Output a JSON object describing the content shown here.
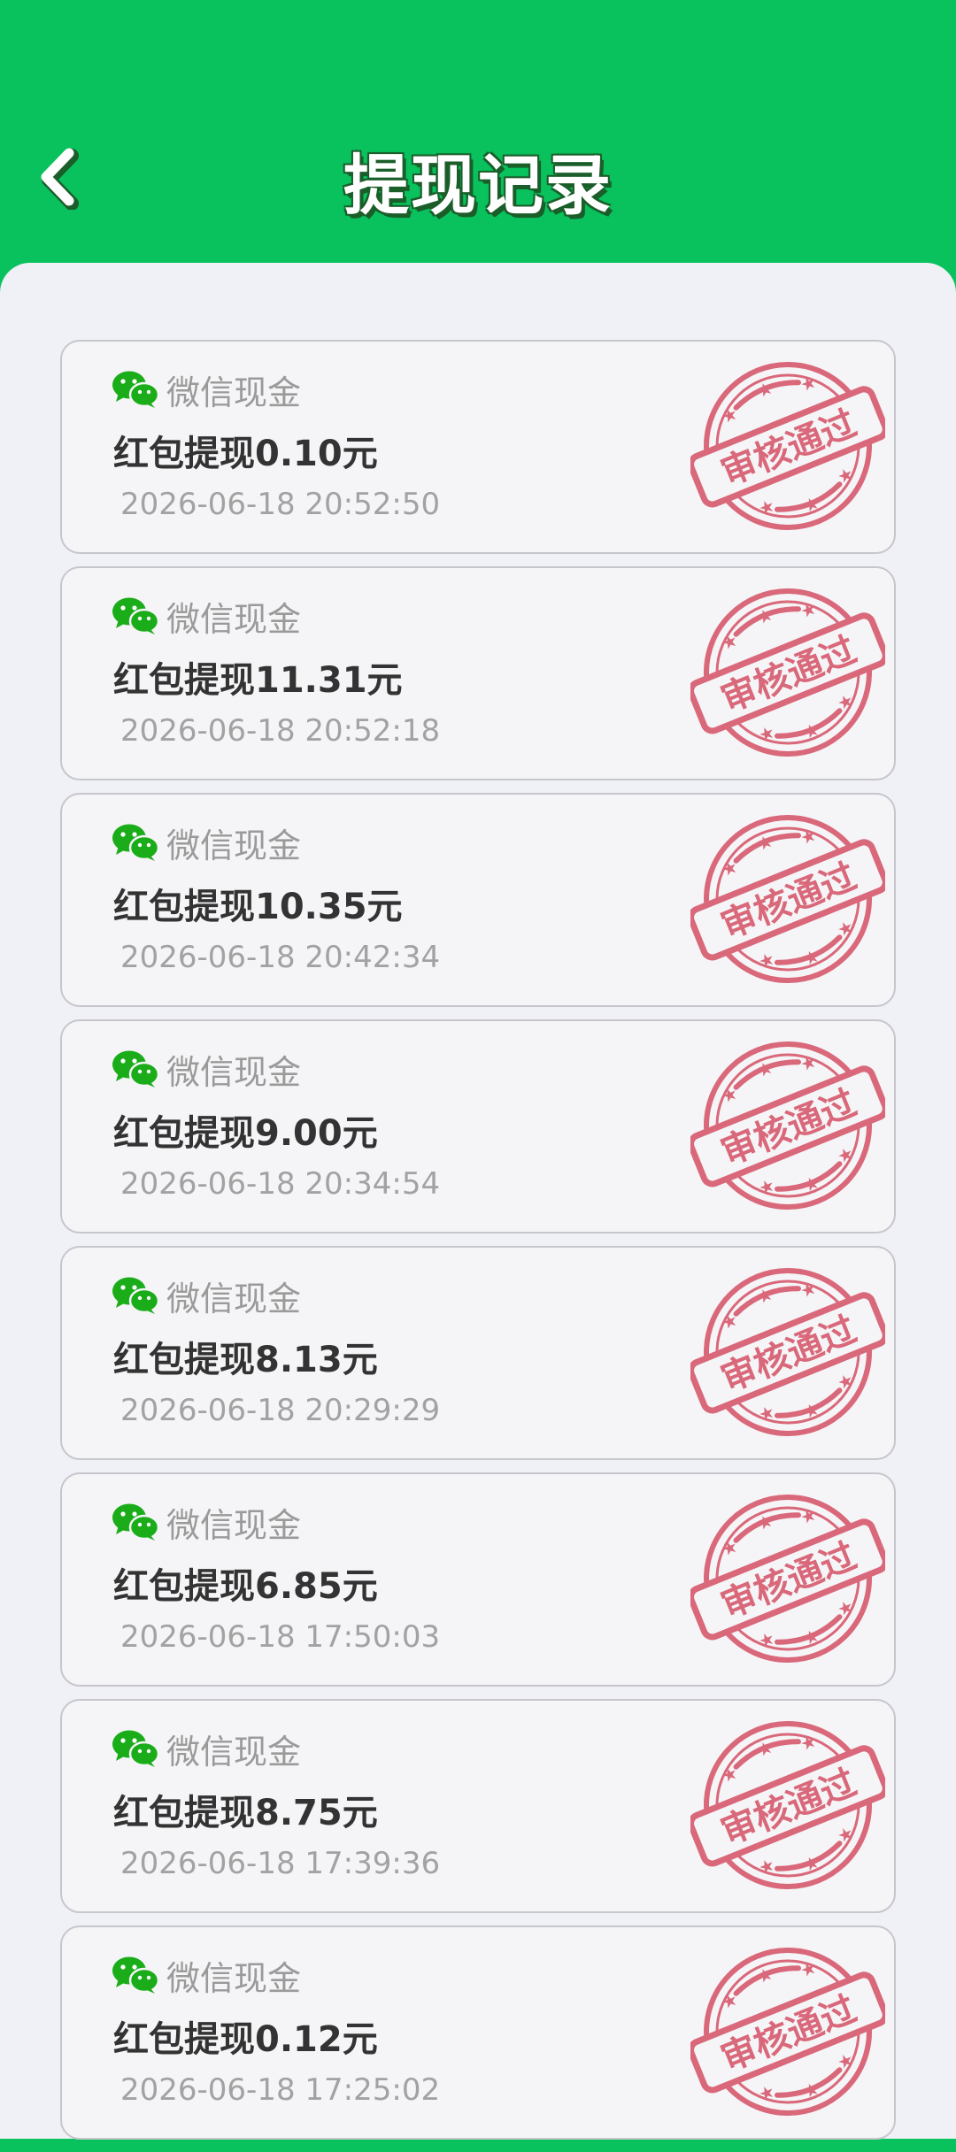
{
  "header": {
    "title": "提现记录",
    "back_icon": "chevron-left-icon"
  },
  "colors": {
    "brand_green": "#09c25e",
    "stamp_red": "#d9687a",
    "wechat_green": "#1aad19"
  },
  "stamp_label": "审核通过",
  "records": [
    {
      "source": "微信现金",
      "title": "红包提现0.10元",
      "time": "2026-06-18 20:52:50"
    },
    {
      "source": "微信现金",
      "title": "红包提现11.31元",
      "time": "2026-06-18 20:52:18"
    },
    {
      "source": "微信现金",
      "title": "红包提现10.35元",
      "time": "2026-06-18 20:42:34"
    },
    {
      "source": "微信现金",
      "title": "红包提现9.00元",
      "time": "2026-06-18 20:34:54"
    },
    {
      "source": "微信现金",
      "title": "红包提现8.13元",
      "time": "2026-06-18 20:29:29"
    },
    {
      "source": "微信现金",
      "title": "红包提现6.85元",
      "time": "2026-06-18 17:50:03"
    },
    {
      "source": "微信现金",
      "title": "红包提现8.75元",
      "time": "2026-06-18 17:39:36"
    },
    {
      "source": "微信现金",
      "title": "红包提现0.12元",
      "time": "2026-06-18 17:25:02"
    }
  ]
}
